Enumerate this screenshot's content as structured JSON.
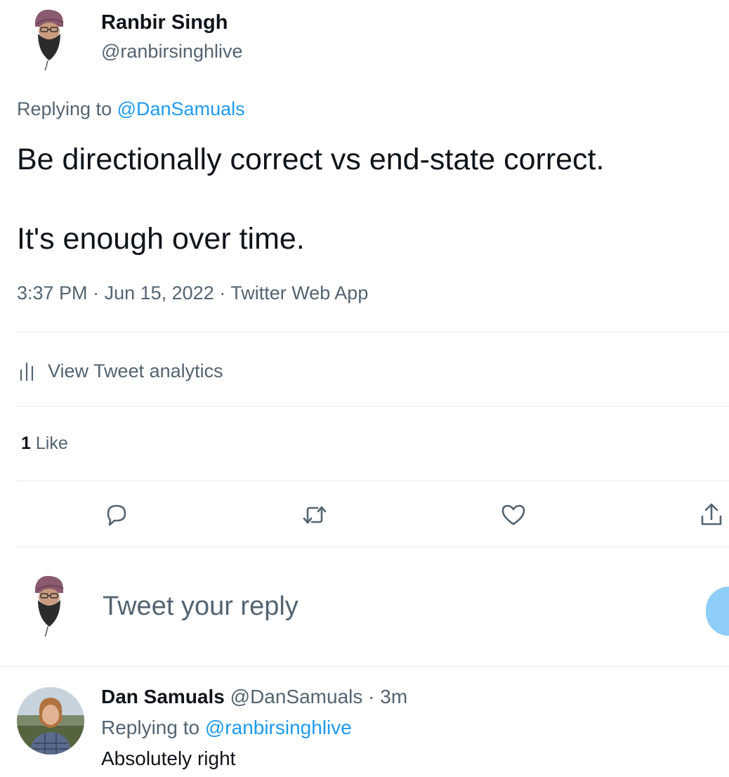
{
  "colors": {
    "accent": "#1d9bf0",
    "text_primary": "#0f1419",
    "text_secondary": "#536471",
    "divider": "#e6ecf0",
    "reply_button": "#8ecdf8"
  },
  "tweet": {
    "author_name": "Ranbir Singh",
    "author_handle": "@ranbirsinghlive",
    "replying_prefix": "Replying to",
    "replying_to": "@DanSamuals",
    "text_line1": "Be directionally correct vs end-state correct.",
    "text_line2": "It's enough over time.",
    "time": "3:37 PM",
    "date": "Jun 15, 2022",
    "source": "Twitter Web App",
    "analytics_label": "View Tweet analytics",
    "like_count": "1",
    "like_label": "Like",
    "actions": {
      "reply_icon": "reply-bubble-icon",
      "retweet_icon": "retweet-arrows-icon",
      "like_icon": "heart-icon",
      "share_icon": "share-upload-icon"
    }
  },
  "reply_box": {
    "placeholder": "Tweet your reply"
  },
  "comment": {
    "author_name": "Dan Samuals",
    "author_handle": "@DanSamuals",
    "separator": "·",
    "time_ago": "3m",
    "replying_prefix": "Replying to",
    "replying_to": "@ranbirsinghlive",
    "text": "Absolutely right"
  }
}
